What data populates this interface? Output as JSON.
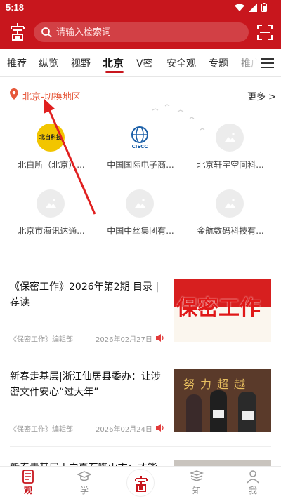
{
  "status_bar": {
    "time": "5:18"
  },
  "search": {
    "placeholder": "请输入检索词"
  },
  "tabs": [
    {
      "label": "推荐"
    },
    {
      "label": "纵览"
    },
    {
      "label": "视野"
    },
    {
      "label": "北京"
    },
    {
      "label": "V密"
    },
    {
      "label": "安全观"
    },
    {
      "label": "专题"
    },
    {
      "label": "推广"
    }
  ],
  "active_tab": "北京",
  "region": {
    "text": "北京-切换地区",
    "more_label": "更多 >"
  },
  "partners": [
    {
      "name": "北白所（北京）...",
      "logo_text": "北自科技"
    },
    {
      "name": "中国国际电子商...",
      "logo_text": "CIECC"
    },
    {
      "name": "北京轩宇空间科..."
    },
    {
      "name": "北京市海讯达通..."
    },
    {
      "name": "中国中丝集团有..."
    },
    {
      "name": "金航数码科技有..."
    }
  ],
  "articles": [
    {
      "title": "《保密工作》2026年第2期 目录 | 荐读",
      "source": "《保密工作》编辑部",
      "date": "2026年02月27日",
      "thumb_text": "保密工作"
    },
    {
      "title": "新春走基层|浙江仙居县委办：让涉密文件安心“过大年”",
      "source": "《保密工作》编辑部",
      "date": "2026年02月24日",
      "thumb_text": "努力超越"
    },
    {
      "title": "新春走基层 | 宁夏石嘴山市：才能服"
    }
  ],
  "bottom_nav": [
    {
      "label": "观",
      "icon": "document-icon"
    },
    {
      "label": "学",
      "icon": "graduation-cap-icon"
    },
    {
      "label": "",
      "icon": "app-logo-icon"
    },
    {
      "label": "知",
      "icon": "books-stack-icon"
    },
    {
      "label": "我",
      "icon": "person-icon"
    }
  ],
  "colors": {
    "brand_red": "#c8161d",
    "region_orange": "#e6583a"
  }
}
